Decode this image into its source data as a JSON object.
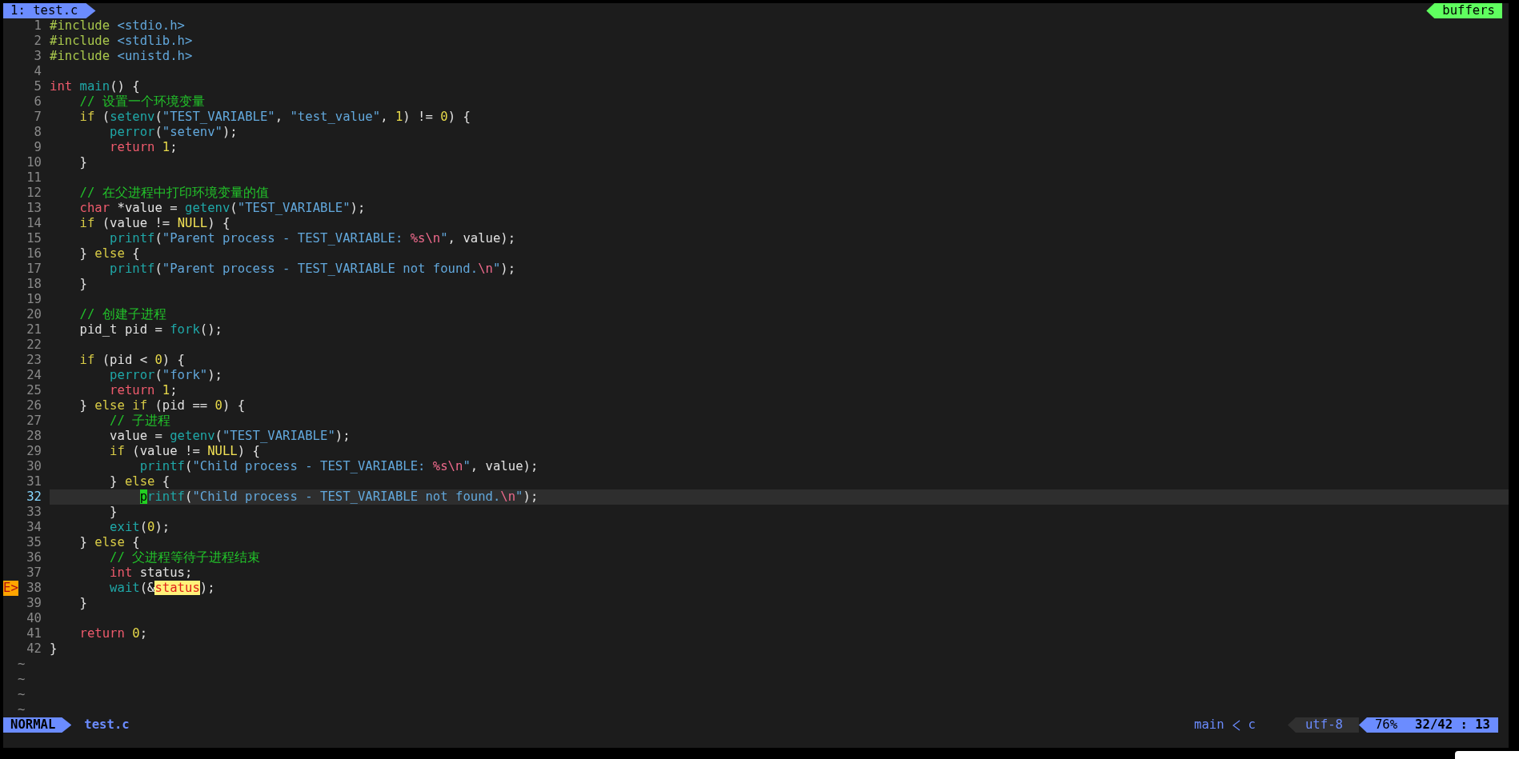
{
  "tabline": {
    "tabs": [
      {
        "label": "1: test.c",
        "selected": true
      }
    ],
    "buffers_label": "buffers"
  },
  "editor": {
    "lines": [
      {
        "number": "1",
        "tokens": [
          {
            "kind": "pp",
            "text": "#include"
          },
          {
            "kind": "inc",
            "text": " <stdio.h>"
          }
        ]
      },
      {
        "number": "2",
        "tokens": [
          {
            "kind": "pp",
            "text": "#include"
          },
          {
            "kind": "inc",
            "text": " <stdlib.h>"
          }
        ]
      },
      {
        "number": "3",
        "tokens": [
          {
            "kind": "pp",
            "text": "#include"
          },
          {
            "kind": "inc",
            "text": " <unistd.h>"
          }
        ]
      },
      {
        "number": "4"
      },
      {
        "number": "5",
        "tokens": [
          {
            "kind": "ty",
            "text": "int"
          },
          {
            "kind": "fn",
            "text": " main"
          },
          {
            "kind": "p",
            "text": "() {"
          }
        ]
      },
      {
        "number": "6",
        "tokens": [
          {
            "kind": "cm",
            "text": "    // 设置一个环境变量"
          }
        ]
      },
      {
        "number": "7",
        "tokens": [
          {
            "kind": "cond",
            "text": "    if"
          },
          {
            "kind": "p",
            "text": " ("
          },
          {
            "kind": "fn",
            "text": "setenv"
          },
          {
            "kind": "p",
            "text": "("
          },
          {
            "kind": "str",
            "text": "\"TEST_VARIABLE\""
          },
          {
            "kind": "p",
            "text": ", "
          },
          {
            "kind": "str",
            "text": "\"test_value\""
          },
          {
            "kind": "p",
            "text": ", "
          },
          {
            "kind": "num",
            "text": "1"
          },
          {
            "kind": "p",
            "text": ") != "
          },
          {
            "kind": "num",
            "text": "0"
          },
          {
            "kind": "p",
            "text": ") {"
          }
        ]
      },
      {
        "number": "8",
        "tokens": [
          {
            "kind": "fn",
            "text": "        perror"
          },
          {
            "kind": "p",
            "text": "("
          },
          {
            "kind": "str",
            "text": "\"setenv\""
          },
          {
            "kind": "p",
            "text": ");"
          }
        ]
      },
      {
        "number": "9",
        "tokens": [
          {
            "kind": "kw",
            "text": "        return"
          },
          {
            "kind": "num",
            "text": " 1"
          },
          {
            "kind": "p",
            "text": ";"
          }
        ]
      },
      {
        "number": "10",
        "tokens": [
          {
            "kind": "p",
            "text": "    }"
          }
        ]
      },
      {
        "number": "11"
      },
      {
        "number": "12",
        "tokens": [
          {
            "kind": "cm",
            "text": "    // 在父进程中打印环境变量的值"
          }
        ]
      },
      {
        "number": "13",
        "tokens": [
          {
            "kind": "ty",
            "text": "    char"
          },
          {
            "kind": "p",
            "text": " *value = "
          },
          {
            "kind": "fn",
            "text": "getenv"
          },
          {
            "kind": "p",
            "text": "("
          },
          {
            "kind": "str",
            "text": "\"TEST_VARIABLE\""
          },
          {
            "kind": "p",
            "text": ");"
          }
        ]
      },
      {
        "number": "14",
        "tokens": [
          {
            "kind": "cond",
            "text": "    if"
          },
          {
            "kind": "p",
            "text": " (value != "
          },
          {
            "kind": "const",
            "text": "NULL"
          },
          {
            "kind": "p",
            "text": ") {"
          }
        ]
      },
      {
        "number": "15",
        "tokens": [
          {
            "kind": "fn",
            "text": "        printf"
          },
          {
            "kind": "p",
            "text": "("
          },
          {
            "kind": "str",
            "text": "\"Parent process - TEST_VARIABLE: "
          },
          {
            "kind": "esc",
            "text": "%s\\n"
          },
          {
            "kind": "str",
            "text": "\""
          },
          {
            "kind": "p",
            "text": ", value);"
          }
        ]
      },
      {
        "number": "16",
        "tokens": [
          {
            "kind": "p",
            "text": "    } "
          },
          {
            "kind": "cond",
            "text": "else"
          },
          {
            "kind": "p",
            "text": " {"
          }
        ]
      },
      {
        "number": "17",
        "tokens": [
          {
            "kind": "fn",
            "text": "        printf"
          },
          {
            "kind": "p",
            "text": "("
          },
          {
            "kind": "str",
            "text": "\"Parent process - TEST_VARIABLE not found."
          },
          {
            "kind": "esc",
            "text": "\\n"
          },
          {
            "kind": "str",
            "text": "\""
          },
          {
            "kind": "p",
            "text": ");"
          }
        ]
      },
      {
        "number": "18",
        "tokens": [
          {
            "kind": "p",
            "text": "    }"
          }
        ]
      },
      {
        "number": "19"
      },
      {
        "number": "20",
        "tokens": [
          {
            "kind": "cm",
            "text": "    // 创建子进程"
          }
        ]
      },
      {
        "number": "21",
        "tokens": [
          {
            "kind": "p",
            "text": "    pid_t pid = "
          },
          {
            "kind": "fn",
            "text": "fork"
          },
          {
            "kind": "p",
            "text": "();"
          }
        ]
      },
      {
        "number": "22"
      },
      {
        "number": "23",
        "tokens": [
          {
            "kind": "cond",
            "text": "    if"
          },
          {
            "kind": "p",
            "text": " (pid < "
          },
          {
            "kind": "num",
            "text": "0"
          },
          {
            "kind": "p",
            "text": ") {"
          }
        ]
      },
      {
        "number": "24",
        "tokens": [
          {
            "kind": "fn",
            "text": "        perror"
          },
          {
            "kind": "p",
            "text": "("
          },
          {
            "kind": "str",
            "text": "\"fork\""
          },
          {
            "kind": "p",
            "text": ");"
          }
        ]
      },
      {
        "number": "25",
        "tokens": [
          {
            "kind": "kw",
            "text": "        return"
          },
          {
            "kind": "num",
            "text": " 1"
          },
          {
            "kind": "p",
            "text": ";"
          }
        ]
      },
      {
        "number": "26",
        "tokens": [
          {
            "kind": "p",
            "text": "    } "
          },
          {
            "kind": "cond",
            "text": "else if"
          },
          {
            "kind": "p",
            "text": " (pid == "
          },
          {
            "kind": "num",
            "text": "0"
          },
          {
            "kind": "p",
            "text": ") {"
          }
        ]
      },
      {
        "number": "27",
        "tokens": [
          {
            "kind": "cm",
            "text": "        // 子进程"
          }
        ]
      },
      {
        "number": "28",
        "tokens": [
          {
            "kind": "p",
            "text": "        value = "
          },
          {
            "kind": "fn",
            "text": "getenv"
          },
          {
            "kind": "p",
            "text": "("
          },
          {
            "kind": "str",
            "text": "\"TEST_VARIABLE\""
          },
          {
            "kind": "p",
            "text": ");"
          }
        ]
      },
      {
        "number": "29",
        "tokens": [
          {
            "kind": "cond",
            "text": "        if"
          },
          {
            "kind": "p",
            "text": " (value != "
          },
          {
            "kind": "const",
            "text": "NULL"
          },
          {
            "kind": "p",
            "text": ") {"
          }
        ]
      },
      {
        "number": "30",
        "tokens": [
          {
            "kind": "fn",
            "text": "            printf"
          },
          {
            "kind": "p",
            "text": "("
          },
          {
            "kind": "str",
            "text": "\"Child process - TEST_VARIABLE: "
          },
          {
            "kind": "esc",
            "text": "%s\\n"
          },
          {
            "kind": "str",
            "text": "\""
          },
          {
            "kind": "p",
            "text": ", value);"
          }
        ]
      },
      {
        "number": "31",
        "tokens": [
          {
            "kind": "p",
            "text": "        } "
          },
          {
            "kind": "cond",
            "text": "else"
          },
          {
            "kind": "p",
            "text": " {"
          }
        ]
      },
      {
        "number": "32",
        "current": true,
        "tokens": [
          {
            "kind": "cur",
            "text": "            p"
          },
          {
            "kind": "fn",
            "text": "rintf"
          },
          {
            "kind": "p",
            "text": "("
          },
          {
            "kind": "str",
            "text": "\"Child process - TEST_VARIABLE not found."
          },
          {
            "kind": "esc",
            "text": "\\n"
          },
          {
            "kind": "str",
            "text": "\""
          },
          {
            "kind": "p",
            "text": ");"
          }
        ]
      },
      {
        "number": "33",
        "tokens": [
          {
            "kind": "p",
            "text": "        }"
          }
        ]
      },
      {
        "number": "34",
        "tokens": [
          {
            "kind": "fn",
            "text": "        exit"
          },
          {
            "kind": "p",
            "text": "("
          },
          {
            "kind": "num",
            "text": "0"
          },
          {
            "kind": "p",
            "text": ");"
          }
        ]
      },
      {
        "number": "35",
        "tokens": [
          {
            "kind": "p",
            "text": "    } "
          },
          {
            "kind": "cond",
            "text": "else"
          },
          {
            "kind": "p",
            "text": " {"
          }
        ]
      },
      {
        "number": "36",
        "tokens": [
          {
            "kind": "cm",
            "text": "        // 父进程等待子进程结束"
          }
        ]
      },
      {
        "number": "37",
        "tokens": [
          {
            "kind": "ty",
            "text": "        int"
          },
          {
            "kind": "p",
            "text": " status;"
          }
        ]
      },
      {
        "number": "38",
        "sign": "E>",
        "tokens": [
          {
            "kind": "fn",
            "text": "        wait"
          },
          {
            "kind": "p",
            "text": "(&"
          },
          {
            "kind": "hl",
            "text": "status"
          },
          {
            "kind": "p",
            "text": ");"
          }
        ]
      },
      {
        "number": "39",
        "tokens": [
          {
            "kind": "p",
            "text": "    }"
          }
        ]
      },
      {
        "number": "40"
      },
      {
        "number": "41",
        "tokens": [
          {
            "kind": "kw",
            "text": "    return"
          },
          {
            "kind": "num",
            "text": " 0"
          },
          {
            "kind": "p",
            "text": ";"
          }
        ]
      },
      {
        "number": "42",
        "tokens": [
          {
            "kind": "p",
            "text": "}"
          }
        ]
      }
    ],
    "filler": [
      "~",
      "~",
      "~",
      "~"
    ]
  },
  "statusline": {
    "mode": "NORMAL",
    "filename": "test.c",
    "function": "main",
    "filetype": "c",
    "encoding": "utf-8",
    "percent": "76%",
    "position": "32/42 : 13"
  }
}
